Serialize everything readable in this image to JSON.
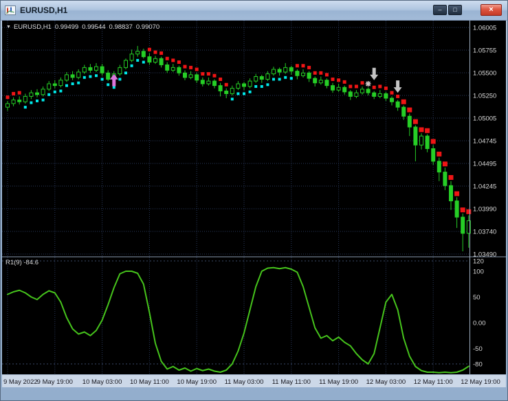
{
  "window": {
    "title": "EURUSD,H1",
    "controls": {
      "minimize": "–",
      "restore": "□",
      "close": "×"
    }
  },
  "chart": {
    "ohlc_label": {
      "dropdown_icon": "▼",
      "symbol": "EURUSD,H1",
      "open": "0.99499",
      "high": "0.99544",
      "low": "0.98837",
      "close": "0.99070"
    },
    "colors": {
      "background": "#000000",
      "grid": "#2A3A5E",
      "candle": "#26CE26",
      "trend_up": "#00E8E8",
      "trend_down": "#EF1515",
      "buy_arrow": "#DB76DC",
      "sell_arrow": "#C4C4C4",
      "oscillator": "#46C41C",
      "axis_text": "#D9D9D9",
      "time_text": "#15151D",
      "separator": "#8A9AB0",
      "axis_border": "#9FB0C2",
      "time_strip_bg": "#CCD8E8",
      "level_line": "#3A4A6A"
    }
  },
  "indicator": {
    "label": "R1(9) -84.6"
  },
  "chart_data": {
    "type": "candlestick",
    "title": "EURUSD,H1",
    "symbol": "EURUSD",
    "timeframe": "H1",
    "price_axis_labels": [
      "1.06005",
      "1.05755",
      "1.05500",
      "1.05250",
      "1.05005",
      "1.04745",
      "1.04495",
      "1.04245",
      "1.03990",
      "1.03740",
      "1.03490"
    ],
    "time_axis_labels": [
      "9 May 2022",
      "9 May 19:00",
      "10 May 03:00",
      "10 May 11:00",
      "10 May 19:00",
      "11 May 03:00",
      "11 May 11:00",
      "11 May 19:00",
      "12 May 03:00",
      "12 May 11:00",
      "12 May 19:00"
    ],
    "candles": [
      [
        1.0512,
        1.0519,
        1.0508,
        1.0516
      ],
      [
        1.0516,
        1.0523,
        1.0513,
        1.052
      ],
      [
        1.052,
        1.0524,
        1.0515,
        1.0518
      ],
      [
        1.0518,
        1.0527,
        1.0516,
        1.0524
      ],
      [
        1.0524,
        1.0531,
        1.0521,
        1.0528
      ],
      [
        1.0528,
        1.0532,
        1.0523,
        1.0526
      ],
      [
        1.0526,
        1.0535,
        1.0524,
        1.0532
      ],
      [
        1.0532,
        1.0541,
        1.053,
        1.0538
      ],
      [
        1.0538,
        1.0542,
        1.0533,
        1.0536
      ],
      [
        1.0536,
        1.0545,
        1.0534,
        1.0542
      ],
      [
        1.0542,
        1.0551,
        1.054,
        1.0548
      ],
      [
        1.0548,
        1.0552,
        1.0542,
        1.0545
      ],
      [
        1.0545,
        1.0554,
        1.0543,
        1.0551
      ],
      [
        1.0551,
        1.0559,
        1.0549,
        1.0556
      ],
      [
        1.0556,
        1.056,
        1.055,
        1.0553
      ],
      [
        1.0553,
        1.0561,
        1.0551,
        1.0557
      ],
      [
        1.0557,
        1.056,
        1.0547,
        1.055
      ],
      [
        1.055,
        1.0553,
        1.0541,
        1.0543
      ],
      [
        1.0543,
        1.0552,
        1.0538,
        1.0549
      ],
      [
        1.0549,
        1.0559,
        1.0547,
        1.0556
      ],
      [
        1.0556,
        1.0566,
        1.0554,
        1.0564
      ],
      [
        1.0564,
        1.0576,
        1.0562,
        1.0571
      ],
      [
        1.0571,
        1.058,
        1.0568,
        1.0574
      ],
      [
        1.0574,
        1.0577,
        1.0566,
        1.0568
      ],
      [
        1.0568,
        1.0572,
        1.0559,
        1.0562
      ],
      [
        1.0562,
        1.0569,
        1.056,
        1.0566
      ],
      [
        1.0566,
        1.0568,
        1.0556,
        1.0559
      ],
      [
        1.0559,
        1.0562,
        1.055,
        1.0553
      ],
      [
        1.0553,
        1.056,
        1.0551,
        1.0556
      ],
      [
        1.0556,
        1.0558,
        1.0547,
        1.055
      ],
      [
        1.055,
        1.0553,
        1.0542,
        1.0545
      ],
      [
        1.0545,
        1.0552,
        1.0543,
        1.0548
      ],
      [
        1.0548,
        1.055,
        1.0539,
        1.0542
      ],
      [
        1.0542,
        1.0545,
        1.0535,
        1.0538
      ],
      [
        1.0538,
        1.0545,
        1.0536,
        1.0541
      ],
      [
        1.0541,
        1.0543,
        1.0533,
        1.0536
      ],
      [
        1.0536,
        1.0539,
        1.0524,
        1.053
      ],
      [
        1.053,
        1.0533,
        1.0522,
        1.0527
      ],
      [
        1.0527,
        1.0536,
        1.0525,
        1.0533
      ],
      [
        1.0533,
        1.0541,
        1.0531,
        1.0538
      ],
      [
        1.0538,
        1.054,
        1.0531,
        1.0535
      ],
      [
        1.0535,
        1.0544,
        1.0533,
        1.0541
      ],
      [
        1.0541,
        1.0549,
        1.0539,
        1.0546
      ],
      [
        1.0546,
        1.0548,
        1.0539,
        1.0543
      ],
      [
        1.0543,
        1.0552,
        1.0541,
        1.0549
      ],
      [
        1.0549,
        1.0557,
        1.0547,
        1.0554
      ],
      [
        1.0554,
        1.0556,
        1.0547,
        1.0551
      ],
      [
        1.0551,
        1.0561,
        1.0549,
        1.0556
      ],
      [
        1.0556,
        1.0558,
        1.0548,
        1.0552
      ],
      [
        1.0552,
        1.0554,
        1.0543,
        1.0547
      ],
      [
        1.0547,
        1.0554,
        1.0545,
        1.055
      ],
      [
        1.055,
        1.0552,
        1.054,
        1.0544
      ],
      [
        1.0544,
        1.0546,
        1.0535,
        1.0539
      ],
      [
        1.0539,
        1.0546,
        1.0537,
        1.0542
      ],
      [
        1.0542,
        1.0544,
        1.0533,
        1.0536
      ],
      [
        1.0536,
        1.0539,
        1.0528,
        1.0531
      ],
      [
        1.0531,
        1.0538,
        1.0529,
        1.0534
      ],
      [
        1.0534,
        1.0536,
        1.0526,
        1.0529
      ],
      [
        1.0529,
        1.0531,
        1.052,
        1.0524
      ],
      [
        1.0524,
        1.0531,
        1.0522,
        1.0528
      ],
      [
        1.0528,
        1.0535,
        1.0526,
        1.0532
      ],
      [
        1.0532,
        1.0534,
        1.0525,
        1.0528
      ],
      [
        1.0528,
        1.053,
        1.0521,
        1.0524
      ],
      [
        1.0524,
        1.0531,
        1.0522,
        1.0527
      ],
      [
        1.0527,
        1.0529,
        1.0519,
        1.0522
      ],
      [
        1.0522,
        1.0524,
        1.0514,
        1.0518
      ],
      [
        1.0518,
        1.052,
        1.0508,
        1.0512
      ],
      [
        1.0512,
        1.0514,
        1.0498,
        1.0502
      ],
      [
        1.0502,
        1.0505,
        1.048,
        1.049
      ],
      [
        1.049,
        1.0492,
        1.0452,
        1.047
      ],
      [
        1.047,
        1.0483,
        1.0465,
        1.048
      ],
      [
        1.048,
        1.0482,
        1.0462,
        1.0466
      ],
      [
        1.0466,
        1.047,
        1.0448,
        1.0452
      ],
      [
        1.0452,
        1.0456,
        1.043,
        1.044
      ],
      [
        1.044,
        1.0445,
        1.042,
        1.0425
      ],
      [
        1.0425,
        1.043,
        1.0398,
        1.0408
      ],
      [
        1.0408,
        1.0412,
        1.0378,
        1.039
      ],
      [
        1.039,
        1.0394,
        1.0352,
        1.0372
      ],
      [
        1.0372,
        1.0392,
        1.0356,
        1.0386
      ]
    ],
    "trend_dots": {
      "up_color_name": "aqua",
      "down_color_name": "red",
      "segments": [
        {
          "from": 0,
          "to": 2,
          "dir": "down",
          "size": 5
        },
        {
          "from": 3,
          "to": 23,
          "dir": "up",
          "size": 4
        },
        {
          "from": 24,
          "to": 37,
          "dir": "down",
          "size": 5
        },
        {
          "from": 38,
          "to": 48,
          "dir": "up",
          "size": 4
        },
        {
          "from": 49,
          "to": 66,
          "dir": "down",
          "size": 5
        },
        {
          "from": 67,
          "to": 78,
          "dir": "down",
          "size": 7
        }
      ]
    },
    "arrows": [
      {
        "bar": 18,
        "price": 1.0549,
        "type": "up",
        "color_key": "buy_arrow"
      },
      {
        "bar": 61,
        "price": 1.0538,
        "type": "star",
        "color_key": "sell_arrow"
      },
      {
        "bar": 62,
        "price": 1.0542,
        "type": "down",
        "color_key": "sell_arrow"
      },
      {
        "bar": 66,
        "price": 1.0528,
        "type": "down",
        "color_key": "sell_arrow"
      }
    ],
    "oscillator": {
      "label": "R1(9)",
      "period": 9,
      "last_value": -84.6,
      "range": [
        -100,
        126
      ],
      "levels": [
        120,
        -80
      ],
      "scale": [
        {
          "label": "120",
          "value": 120
        },
        {
          "label": "100",
          "value": 100
        },
        {
          "label": "50",
          "value": 50
        },
        {
          "label": "0.00",
          "value": 0
        },
        {
          "label": "-50",
          "value": -50
        },
        {
          "label": "-80",
          "value": -80
        }
      ],
      "values": [
        55,
        60,
        63,
        58,
        50,
        45,
        55,
        62,
        58,
        40,
        10,
        -12,
        -22,
        -18,
        -25,
        -15,
        5,
        35,
        68,
        95,
        100,
        100,
        96,
        75,
        20,
        -40,
        -75,
        -90,
        -85,
        -92,
        -88,
        -94,
        -89,
        -93,
        -90,
        -94,
        -96,
        -92,
        -80,
        -55,
        -20,
        25,
        70,
        100,
        106,
        107,
        105,
        107,
        104,
        98,
        70,
        30,
        -10,
        -30,
        -25,
        -35,
        -28,
        -38,
        -45,
        -60,
        -72,
        -80,
        -60,
        -10,
        40,
        55,
        25,
        -30,
        -65,
        -85,
        -93,
        -96,
        -96,
        -97,
        -96,
        -97,
        -96,
        -92,
        -84.6
      ]
    }
  }
}
